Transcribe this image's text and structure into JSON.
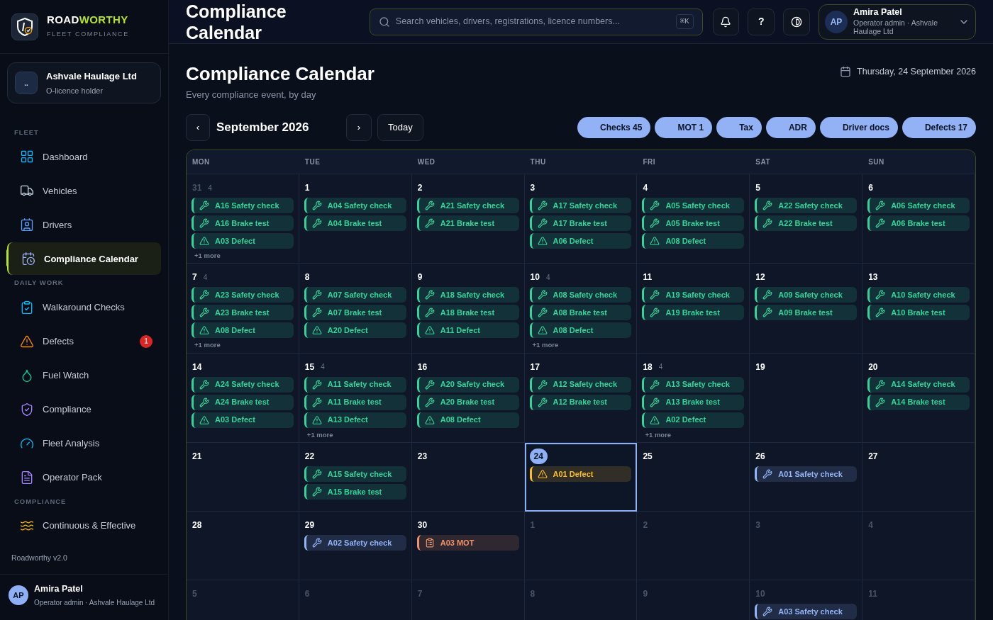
{
  "brand": {
    "word_a": "ROAD",
    "word_b": "WORTHY",
    "tagline": "FLEET COMPLIANCE"
  },
  "org": {
    "avatar": "..",
    "name": "Ashvale Haulage Ltd",
    "role": "O-licence holder"
  },
  "nav": [
    {
      "section": "FLEET",
      "items": [
        {
          "label": "Dashboard",
          "selected": false
        },
        {
          "label": "Vehicles",
          "selected": false
        },
        {
          "label": "Drivers",
          "selected": false
        },
        {
          "label": "Compliance Calendar",
          "selected": true
        }
      ]
    },
    {
      "section": "DAILY WORK",
      "items": [
        {
          "label": "Walkaround Checks",
          "selected": false
        },
        {
          "label": "Defects",
          "selected": false,
          "badge": "1"
        },
        {
          "label": "Fuel Watch",
          "selected": false
        },
        {
          "label": "Compliance",
          "selected": false
        },
        {
          "label": "Fleet Analysis",
          "selected": false
        },
        {
          "label": "Operator Pack",
          "selected": false
        }
      ]
    },
    {
      "section": "COMPLIANCE",
      "items": [
        {
          "label": "Continuous & Effective",
          "selected": false
        }
      ]
    }
  ],
  "version": "Roadworthy v2.0",
  "sidebar_user": {
    "avatar": "AP",
    "name": "Amira Patel",
    "role": "Operator admin · Ashvale Haulage Ltd"
  },
  "topbar": {
    "title": "Compliance Calendar",
    "search": {
      "placeholder": "Search vehicles, drivers, registrations, licence numbers...",
      "shortcut": "⌘K"
    },
    "help": "?",
    "user": {
      "avatar": "AP",
      "name": "Amira Patel",
      "role": "Operator admin · Ashvale Haulage Ltd"
    }
  },
  "page": {
    "title": "Compliance Calendar",
    "subtitle": "Every compliance event, by day",
    "date": "Thursday, 24 September 2026"
  },
  "toolbar": {
    "month": "September 2026",
    "prev": "‹",
    "next": "›",
    "today": "Today"
  },
  "filters": [
    {
      "label": "Checks 45",
      "selected": true
    },
    {
      "label": "MOT 1",
      "selected": true
    },
    {
      "label": "Tax",
      "selected": true
    },
    {
      "label": "ADR",
      "selected": true
    },
    {
      "label": "Driver docs",
      "selected": true
    },
    {
      "label": "Defects 17",
      "selected": true
    }
  ],
  "weekdays": [
    "MON",
    "TUE",
    "WED",
    "THU",
    "FRI",
    "SAT",
    "SUN"
  ],
  "weeks": [
    [
      {
        "day": "31",
        "outside": true,
        "today": false,
        "count": "4",
        "more": "+1 more",
        "events": [
          {
            "kind": "check",
            "label": "A16 Safety check",
            "color": "#34d399"
          },
          {
            "kind": "check",
            "label": "A16 Brake test",
            "color": "#34d399"
          },
          {
            "kind": "defect",
            "label": "A03 Defect",
            "color": "#34d399"
          }
        ]
      },
      {
        "day": "1",
        "outside": false,
        "today": false,
        "events": [
          {
            "kind": "check",
            "label": "A04 Safety check",
            "color": "#34d399"
          },
          {
            "kind": "check",
            "label": "A04 Brake test",
            "color": "#34d399"
          }
        ]
      },
      {
        "day": "2",
        "outside": false,
        "today": false,
        "events": [
          {
            "kind": "check",
            "label": "A21 Safety check",
            "color": "#34d399"
          },
          {
            "kind": "check",
            "label": "A21 Brake test",
            "color": "#34d399"
          }
        ]
      },
      {
        "day": "3",
        "outside": false,
        "today": false,
        "events": [
          {
            "kind": "check",
            "label": "A17 Safety check",
            "color": "#34d399"
          },
          {
            "kind": "check",
            "label": "A17 Brake test",
            "color": "#34d399"
          },
          {
            "kind": "defect",
            "label": "A06 Defect",
            "color": "#34d399"
          }
        ]
      },
      {
        "day": "4",
        "outside": false,
        "today": false,
        "events": [
          {
            "kind": "check",
            "label": "A05 Safety check",
            "color": "#34d399"
          },
          {
            "kind": "check",
            "label": "A05 Brake test",
            "color": "#34d399"
          },
          {
            "kind": "defect",
            "label": "A08 Defect",
            "color": "#34d399"
          }
        ]
      },
      {
        "day": "5",
        "outside": false,
        "today": false,
        "events": [
          {
            "kind": "check",
            "label": "A22 Safety check",
            "color": "#34d399"
          },
          {
            "kind": "check",
            "label": "A22 Brake test",
            "color": "#34d399"
          }
        ]
      },
      {
        "day": "6",
        "outside": false,
        "today": false,
        "events": [
          {
            "kind": "check",
            "label": "A06 Safety check",
            "color": "#34d399"
          },
          {
            "kind": "check",
            "label": "A06 Brake test",
            "color": "#34d399"
          }
        ]
      }
    ],
    [
      {
        "day": "7",
        "outside": false,
        "today": false,
        "count": "4",
        "more": "+1 more",
        "events": [
          {
            "kind": "check",
            "label": "A23 Safety check",
            "color": "#34d399"
          },
          {
            "kind": "check",
            "label": "A23 Brake test",
            "color": "#34d399"
          },
          {
            "kind": "defect",
            "label": "A08 Defect",
            "color": "#34d399"
          }
        ]
      },
      {
        "day": "8",
        "outside": false,
        "today": false,
        "events": [
          {
            "kind": "check",
            "label": "A07 Safety check",
            "color": "#34d399"
          },
          {
            "kind": "check",
            "label": "A07 Brake test",
            "color": "#34d399"
          },
          {
            "kind": "defect",
            "label": "A20 Defect",
            "color": "#34d399"
          }
        ]
      },
      {
        "day": "9",
        "outside": false,
        "today": false,
        "events": [
          {
            "kind": "check",
            "label": "A18 Safety check",
            "color": "#34d399"
          },
          {
            "kind": "check",
            "label": "A18 Brake test",
            "color": "#34d399"
          },
          {
            "kind": "defect",
            "label": "A11 Defect",
            "color": "#34d399"
          }
        ]
      },
      {
        "day": "10",
        "outside": false,
        "today": false,
        "count": "4",
        "more": "+1 more",
        "events": [
          {
            "kind": "check",
            "label": "A08 Safety check",
            "color": "#34d399"
          },
          {
            "kind": "check",
            "label": "A08 Brake test",
            "color": "#34d399"
          },
          {
            "kind": "defect",
            "label": "A08 Defect",
            "color": "#34d399"
          }
        ]
      },
      {
        "day": "11",
        "outside": false,
        "today": false,
        "events": [
          {
            "kind": "check",
            "label": "A19 Safety check",
            "color": "#34d399"
          },
          {
            "kind": "check",
            "label": "A19 Brake test",
            "color": "#34d399"
          }
        ]
      },
      {
        "day": "12",
        "outside": false,
        "today": false,
        "events": [
          {
            "kind": "check",
            "label": "A09 Safety check",
            "color": "#34d399"
          },
          {
            "kind": "check",
            "label": "A09 Brake test",
            "color": "#34d399"
          }
        ]
      },
      {
        "day": "13",
        "outside": false,
        "today": false,
        "events": [
          {
            "kind": "check",
            "label": "A10 Safety check",
            "color": "#34d399"
          },
          {
            "kind": "check",
            "label": "A10 Brake test",
            "color": "#34d399"
          }
        ]
      }
    ],
    [
      {
        "day": "14",
        "outside": false,
        "today": false,
        "events": [
          {
            "kind": "check",
            "label": "A24 Safety check",
            "color": "#34d399"
          },
          {
            "kind": "check",
            "label": "A24 Brake test",
            "color": "#34d399"
          },
          {
            "kind": "defect",
            "label": "A03 Defect",
            "color": "#34d399"
          }
        ]
      },
      {
        "day": "15",
        "outside": false,
        "today": false,
        "count": "4",
        "more": "+1 more",
        "events": [
          {
            "kind": "check",
            "label": "A11 Safety check",
            "color": "#34d399"
          },
          {
            "kind": "check",
            "label": "A11 Brake test",
            "color": "#34d399"
          },
          {
            "kind": "defect",
            "label": "A13 Defect",
            "color": "#34d399"
          }
        ]
      },
      {
        "day": "16",
        "outside": false,
        "today": false,
        "events": [
          {
            "kind": "check",
            "label": "A20 Safety check",
            "color": "#34d399"
          },
          {
            "kind": "check",
            "label": "A20 Brake test",
            "color": "#34d399"
          },
          {
            "kind": "defect",
            "label": "A08 Defect",
            "color": "#34d399"
          }
        ]
      },
      {
        "day": "17",
        "outside": false,
        "today": false,
        "events": [
          {
            "kind": "check",
            "label": "A12 Safety check",
            "color": "#34d399"
          },
          {
            "kind": "check",
            "label": "A12 Brake test",
            "color": "#34d399"
          }
        ]
      },
      {
        "day": "18",
        "outside": false,
        "today": false,
        "count": "4",
        "more": "+1 more",
        "events": [
          {
            "kind": "check",
            "label": "A13 Safety check",
            "color": "#34d399"
          },
          {
            "kind": "check",
            "label": "A13 Brake test",
            "color": "#34d399"
          },
          {
            "kind": "defect",
            "label": "A02 Defect",
            "color": "#34d399"
          }
        ]
      },
      {
        "day": "19",
        "outside": false,
        "today": false
      },
      {
        "day": "20",
        "outside": false,
        "today": false,
        "events": [
          {
            "kind": "check",
            "label": "A14 Safety check",
            "color": "#34d399"
          },
          {
            "kind": "check",
            "label": "A14 Brake test",
            "color": "#34d399"
          }
        ]
      }
    ],
    [
      {
        "day": "21",
        "outside": false,
        "today": false
      },
      {
        "day": "22",
        "outside": false,
        "today": false,
        "events": [
          {
            "kind": "check",
            "label": "A15 Safety check",
            "color": "#34d399"
          },
          {
            "kind": "check",
            "label": "A15 Brake test",
            "color": "#34d399"
          }
        ]
      },
      {
        "day": "23",
        "outside": false,
        "today": false
      },
      {
        "day": "24",
        "outside": false,
        "today": true,
        "events": [
          {
            "kind": "defect",
            "label": "A01 Defect",
            "color": "#fbbf24"
          }
        ]
      },
      {
        "day": "25",
        "outside": false,
        "today": false
      },
      {
        "day": "26",
        "outside": false,
        "today": false,
        "events": [
          {
            "kind": "check",
            "label": "A01 Safety check",
            "color": "#93b4f8"
          }
        ]
      },
      {
        "day": "27",
        "outside": false,
        "today": false
      }
    ],
    [
      {
        "day": "28",
        "outside": false,
        "today": false
      },
      {
        "day": "29",
        "outside": false,
        "today": false,
        "events": [
          {
            "kind": "check",
            "label": "A02 Safety check",
            "color": "#93b4f8"
          }
        ]
      },
      {
        "day": "30",
        "outside": false,
        "today": false,
        "events": [
          {
            "kind": "mot",
            "label": "A03 MOT",
            "color": "#f0926a"
          }
        ]
      },
      {
        "day": "1",
        "outside": true,
        "today": false
      },
      {
        "day": "2",
        "outside": true,
        "today": false
      },
      {
        "day": "3",
        "outside": true,
        "today": false
      },
      {
        "day": "4",
        "outside": true,
        "today": false
      }
    ],
    [
      {
        "day": "5",
        "outside": true,
        "today": false
      },
      {
        "day": "6",
        "outside": true,
        "today": false
      },
      {
        "day": "7",
        "outside": true,
        "today": false
      },
      {
        "day": "8",
        "outside": true,
        "today": false
      },
      {
        "day": "9",
        "outside": true,
        "today": false
      },
      {
        "day": "10",
        "outside": true,
        "today": false,
        "events": [
          {
            "kind": "check",
            "label": "A03 Safety check",
            "color": "#93b4f8"
          }
        ]
      },
      {
        "day": "11",
        "outside": true,
        "today": false
      }
    ]
  ]
}
